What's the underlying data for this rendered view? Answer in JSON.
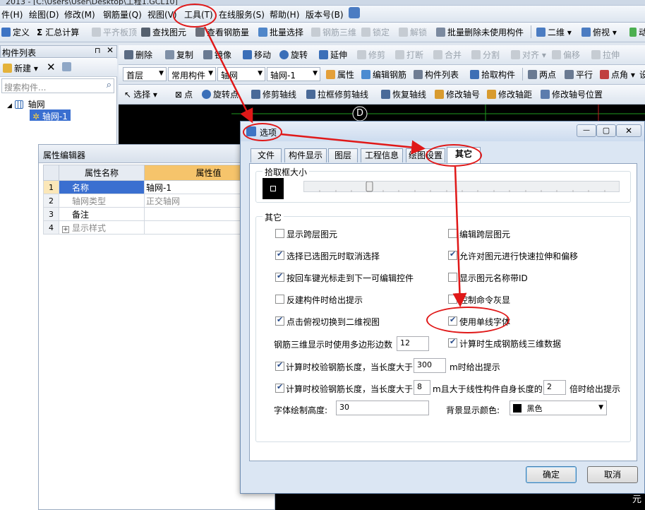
{
  "app": {
    "title_fragment": "2013 - [C:\\Users\\User\\Desktop\\工程1.GCL10]"
  },
  "menu": [
    "件(H)",
    "绘图(D)",
    "修改(M)",
    "钢筋量(Q)",
    "视图(V)",
    "工具(T)",
    "在线服务(S)",
    "帮助(H)",
    "版本号(B)"
  ],
  "toolbar1": {
    "items": [
      "定义",
      "汇总计算",
      "平齐板顶",
      "查找图元",
      "查看钢筋量",
      "批量选择",
      "钢筋三维",
      "锁定",
      "解锁",
      "批量删除未使用构件"
    ],
    "view_2d": "二维",
    "view_top": "俯视",
    "view_dyn": "动"
  },
  "toolbar2": {
    "items": [
      "删除",
      "复制",
      "镜像",
      "移动",
      "旋转",
      "延伸",
      "修剪",
      "打断",
      "合并",
      "分割",
      "对齐",
      "偏移",
      "拉伸"
    ]
  },
  "toolbar3": {
    "floor": "首层",
    "category": "常用构件",
    "type": "轴网",
    "instance": "轴网-1",
    "items": [
      "属性",
      "编辑钢筋",
      "构件列表",
      "拾取构件",
      "两点",
      "平行",
      "点角",
      "设"
    ]
  },
  "toolbar4": {
    "items": [
      "选择",
      "点",
      "旋转点",
      "修剪轴线",
      "拉框修剪轴线",
      "恢复轴线",
      "修改轴号",
      "修改轴距",
      "修改轴号位置"
    ]
  },
  "component_list": {
    "title": "构件列表",
    "new_label": "新建",
    "search_placeholder": "搜索构件...",
    "tree_root": "轴网",
    "tree_child": "轴网-1"
  },
  "property_editor": {
    "title": "属性编辑器",
    "col_name": "属性名称",
    "col_value": "属性值",
    "rows": [
      {
        "num": "1",
        "name": "名称",
        "value": "轴网-1"
      },
      {
        "num": "2",
        "name": "轴网类型",
        "value": "正交轴网"
      },
      {
        "num": "3",
        "name": "备注",
        "value": ""
      },
      {
        "num": "4",
        "name": "显示样式",
        "value": ""
      }
    ]
  },
  "canvas": {
    "axis_label": "D",
    "corner_text": "元"
  },
  "dialog": {
    "title": "选项",
    "tabs": [
      "文件",
      "构件显示",
      "图层",
      "工程信息",
      "绘图设置",
      "其它"
    ],
    "active_tab": "其它",
    "pick_box_group": "拾取框大小",
    "pick_box_level": 0.2,
    "other_group": "其它",
    "options": [
      {
        "label": "显示跨层图元",
        "checked": false
      },
      {
        "label": "编辑跨层图元",
        "checked": false
      },
      {
        "label": "选择已选图元时取消选择",
        "checked": true
      },
      {
        "label": "允许对图元进行快速拉伸和偏移",
        "checked": true
      },
      {
        "label": "按回车键光标走到下一可编辑控件",
        "checked": true
      },
      {
        "label": "显示图元名称带ID",
        "checked": false
      },
      {
        "label": "反建构件时给出提示",
        "checked": false
      },
      {
        "label": "控制命令灰显",
        "checked": false
      },
      {
        "label": "点击俯视切换到二维视图",
        "checked": true
      },
      {
        "label": "使用单线字体",
        "checked": true
      }
    ],
    "polygon_label": "钢筋三维显示时使用多边形边数",
    "polygon_value": "12",
    "gen_3d": {
      "label": "计算时生成钢筋线三维数据",
      "checked": true
    },
    "check1": {
      "pre": "计算时校验钢筋长度，当长度大于",
      "value": "300",
      "post": "m时给出提示",
      "checked": true
    },
    "check2": {
      "pre": "计算时校验钢筋长度，当长度大于",
      "value": "8",
      "mid": "m且大于线性构件自身长度的",
      "value2": "2",
      "post": "倍时给出提示",
      "checked": true
    },
    "font_height_label": "字体绘制高度:",
    "font_height_value": "30",
    "bg_color_label": "背景显示颜色:",
    "bg_color_value": "黑色",
    "bg_color_hex": "#000000",
    "ok": "确定",
    "cancel": "取消"
  }
}
